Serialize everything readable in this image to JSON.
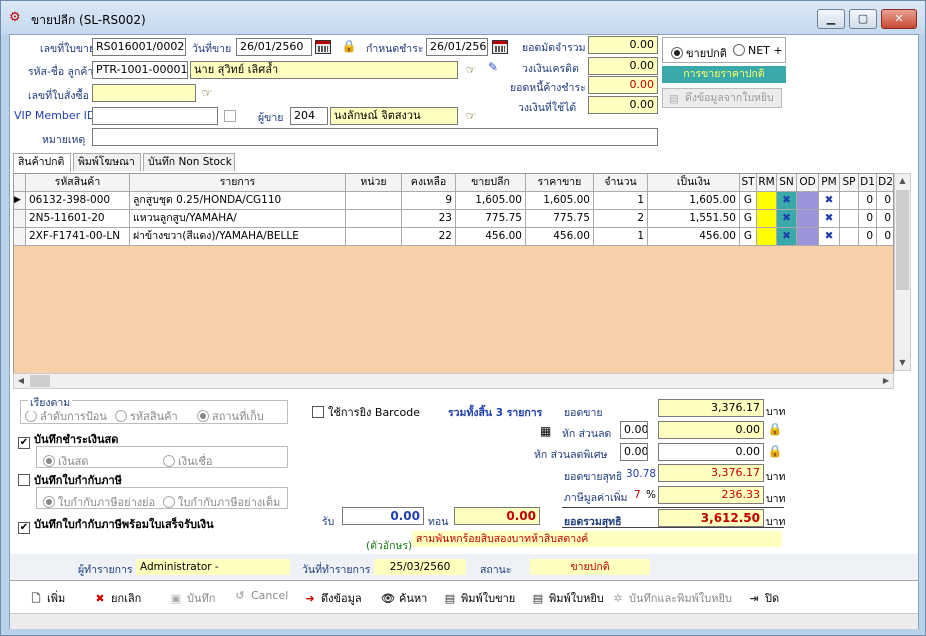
{
  "window": {
    "title": "ขายปลีก (SL-RS002)",
    "min": "▁",
    "max": "▢",
    "close": "✕"
  },
  "header": {
    "doc_no_label": "เลขที่ใบขาย",
    "doc_no": "RS016001/0002",
    "sale_date_label": "วันที่ขาย",
    "sale_date": "26/01/2560",
    "due_label": "กำหนดชำระ",
    "due_date": "26/01/2560",
    "customer_label": "รหัส-ชื่อ ลูกค้า",
    "customer_code": "PTR-1001-00001",
    "customer_name": "นาย สุวิทย์ เลิศล้ำ",
    "order_no_label": "เลขที่ใบสั่งซื้อ",
    "order_no": "",
    "vip_label": "VIP Member ID",
    "vip_id": "",
    "seller_label": "ผู้ขาย",
    "seller_code": "204",
    "seller_name": "นงลักษณ์ จิตสงวน",
    "note_label": "หมายเหตุ",
    "note": ""
  },
  "credit": {
    "deposit_label": "ยอดมัดจำรวม",
    "deposit": "0.00",
    "credit_limit_label": "วงเงินเครดิต",
    "credit_limit": "0.00",
    "outstanding_label": "ยอดหนี้ค้างชำระ",
    "outstanding": "0.00",
    "available_label": "วงเงินที่ใช้ได้",
    "available": "0.00"
  },
  "price_mode": {
    "normal": "ขายปกติ",
    "net": "NET +",
    "badge": "การขายราคาปกติ",
    "pull_btn": "ดึงข้อมูลจากใบหยิบ"
  },
  "tabs": [
    "สินค้าปกติ",
    "พิมพ์โฆษณา",
    "บันทึก Non Stock"
  ],
  "grid": {
    "columns": [
      "รหัสสินค้า",
      "รายการ",
      "หน่วย",
      "คงเหลือ",
      "ขายปลีก",
      "ราคาขาย",
      "จำนวน",
      "เป็นเงิน",
      "ST",
      "RM",
      "SN",
      "OD",
      "PM",
      "SP",
      "D1",
      "D2"
    ],
    "rows": [
      {
        "code": "06132-398-000",
        "desc": "ลูกสูบชุด 0.25/HONDA/CG110",
        "unit": "",
        "stock": "9",
        "retail": "1,605.00",
        "price": "1,605.00",
        "qty": "1",
        "amount": "1,605.00",
        "st": "G",
        "sn": "✖",
        "pm": "✖",
        "d1": "0",
        "d2": "0"
      },
      {
        "code": "2N5-11601-20",
        "desc": "แหวนลูกสูบ/YAMAHA/",
        "unit": "",
        "stock": "23",
        "retail": "775.75",
        "price": "775.75",
        "qty": "2",
        "amount": "1,551.50",
        "st": "G",
        "sn": "✖",
        "pm": "✖",
        "d1": "0",
        "d2": "0"
      },
      {
        "code": "2XF-F1741-00-LN",
        "desc": "ฝาข้างขวา(สีแดง)/YAMAHA/BELLE",
        "unit": "",
        "stock": "22",
        "retail": "456.00",
        "price": "456.00",
        "qty": "1",
        "amount": "456.00",
        "st": "G",
        "sn": "✖",
        "pm": "✖",
        "d1": "0",
        "d2": "0"
      }
    ]
  },
  "options": {
    "sort_label": "เรียงตาม",
    "sort_input": "ลำดับการป้อน",
    "sort_code": "รหัสสินค้า",
    "sort_location": "สถานที่เก็บ",
    "cash_record": "บันทึกชำระเงินสด",
    "cash": "เงินสด",
    "check": "เงินเชื่อ",
    "tax_record": "บันทึกใบกำกับภาษี",
    "tax_short": "ใบกำกับภาษีอย่างย่อ",
    "tax_full": "ใบกำกับภาษีอย่างเต็ม",
    "tax_receipt": "บันทึกใบกำกับภาษีพร้อมใบเสร็จรับเงิน",
    "barcode": "ใช้การยิง Barcode",
    "total_items": "รวมทั้งสิ้น 3 รายการ"
  },
  "payment": {
    "receive_label": "รับ",
    "receive": "0.00",
    "change_label": "ทอน",
    "change": "0.00",
    "words_label": "(ตัวอักษร)",
    "words": "สามพันหกร้อยสิบสองบาทห้าสิบสตางค์"
  },
  "totals": {
    "sales_label": "ยอดขาย",
    "sales": "3,376.17",
    "discount_label": "หัก ส่วนลด",
    "discount_pct": "0.00",
    "discount": "0.00",
    "special_label": "หัก ส่วนลดพิเศษ",
    "special_pct": "0.00",
    "special": "0.00",
    "net_label": "ยอดขายสุทธิ",
    "net_rate": "30.78",
    "net": "3,376.17",
    "vat_label": "ภาษีมูลค่าเพิ่ม",
    "vat_rate": "7",
    "vat": "236.33",
    "grand_label": "ยอดรวมสุทธิ",
    "grand": "3,612.50",
    "baht": "บาท",
    "pct": "%"
  },
  "footer": {
    "user_label": "ผู้ทำรายการ",
    "user": "Administrator -",
    "date_label": "วันที่ทำรายการ",
    "date": "25/03/2560",
    "status_label": "สถานะ",
    "status": "ขายปกติ"
  },
  "toolbar": {
    "add": "เพิ่ม",
    "cancel_doc": "ยกเลิก",
    "save": "บันทึก",
    "cancel": "Cancel",
    "pull": "ดึงข้อมูล",
    "search": "ค้นหา",
    "print_sale": "พิมพ์ใบขาย",
    "print_pick": "พิมพ์ใบหยิบ",
    "save_print_pick": "บันทึกและพิมพ์ใบหยิบ",
    "close": "ปิด"
  }
}
